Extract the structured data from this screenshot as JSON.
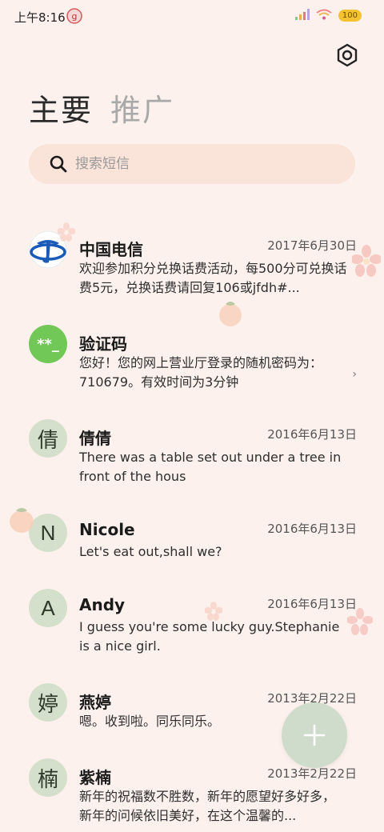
{
  "status_bar": {
    "time": "上午8:16",
    "battery": "100"
  },
  "tabs": [
    {
      "label": "主要",
      "active": true
    },
    {
      "label": "推广",
      "active": false
    }
  ],
  "search": {
    "placeholder": "搜索短信",
    "value": ""
  },
  "conversations": [
    {
      "name": "中国电信",
      "date": "2017年6月30日",
      "preview": "欢迎参加积分兑换话费活动，每500分可兑换话费5元，兑换话费请回复106或jfdh#...",
      "avatar": "telecom-logo"
    },
    {
      "name": "验证码",
      "date": "",
      "preview": "您好！您的网上营业厅登录的随机密码为：710679。有效时间为3分钟",
      "avatar_text": "**_"
    },
    {
      "name": "倩倩",
      "date": "2016年6月13日",
      "preview": "There was a table set out under a tree in front of the hous",
      "avatar_text": "倩"
    },
    {
      "name": "Nicole",
      "date": "2016年6月13日",
      "preview": "Let's eat out,shall we?",
      "avatar_text": "N"
    },
    {
      "name": "Andy",
      "date": "2016年6月13日",
      "preview": "I guess you're some lucky guy.Stephanie is a nice girl.",
      "avatar_text": "A"
    },
    {
      "name": "燕婷",
      "date": "2013年2月22日",
      "preview": "嗯。收到啦。同乐同乐。",
      "avatar_text": "婷"
    },
    {
      "name": "紫楠",
      "date": "2013年2月22日",
      "preview": "新年的祝福数不胜数，新年的愿望好多好多，新年的问候依旧美好，在这个温馨的...",
      "avatar_text": "楠"
    }
  ],
  "colors": {
    "background": "#fcf1ec",
    "search_bg": "#fae3d8",
    "avatar_bg": "#d4e0cc",
    "code_avatar": "#71c856",
    "fab": "#cfdccc",
    "telecom_blue": "#1a5bb8"
  },
  "icons": {
    "settings": "settings-icon",
    "search": "search-icon",
    "compose": "plus-icon",
    "chevron": "chevron-right-icon"
  }
}
